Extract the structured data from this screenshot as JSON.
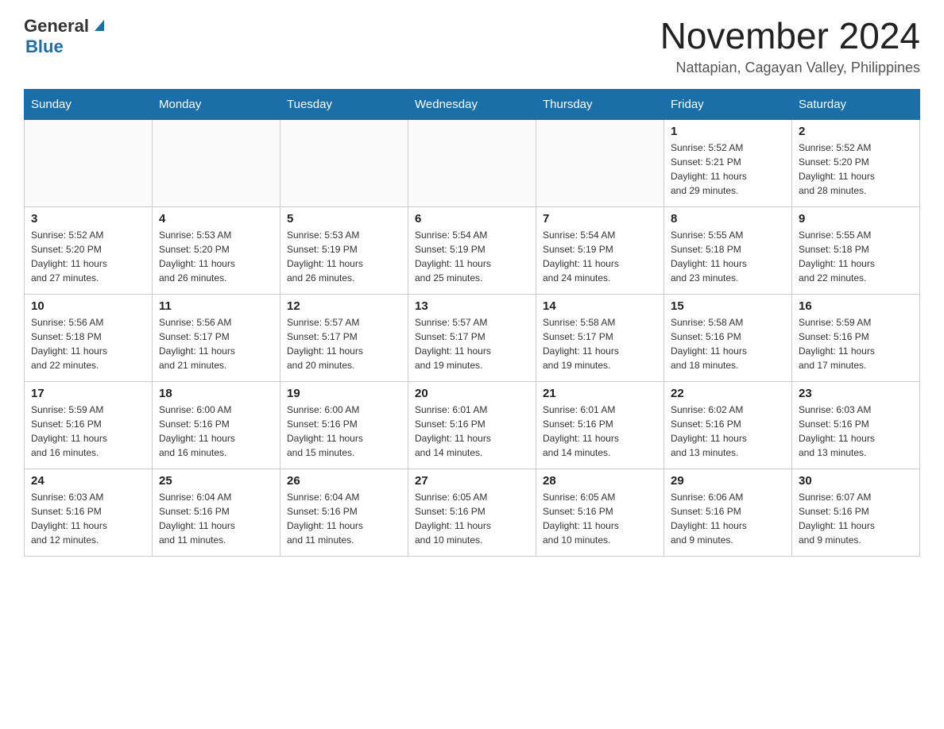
{
  "logo": {
    "general": "General",
    "blue": "Blue",
    "triangle": "▶"
  },
  "title": "November 2024",
  "subtitle": "Nattapian, Cagayan Valley, Philippines",
  "days_of_week": [
    "Sunday",
    "Monday",
    "Tuesday",
    "Wednesday",
    "Thursday",
    "Friday",
    "Saturday"
  ],
  "weeks": [
    {
      "days": [
        {
          "number": "",
          "info": ""
        },
        {
          "number": "",
          "info": ""
        },
        {
          "number": "",
          "info": ""
        },
        {
          "number": "",
          "info": ""
        },
        {
          "number": "",
          "info": ""
        },
        {
          "number": "1",
          "info": "Sunrise: 5:52 AM\nSunset: 5:21 PM\nDaylight: 11 hours\nand 29 minutes."
        },
        {
          "number": "2",
          "info": "Sunrise: 5:52 AM\nSunset: 5:20 PM\nDaylight: 11 hours\nand 28 minutes."
        }
      ]
    },
    {
      "days": [
        {
          "number": "3",
          "info": "Sunrise: 5:52 AM\nSunset: 5:20 PM\nDaylight: 11 hours\nand 27 minutes."
        },
        {
          "number": "4",
          "info": "Sunrise: 5:53 AM\nSunset: 5:20 PM\nDaylight: 11 hours\nand 26 minutes."
        },
        {
          "number": "5",
          "info": "Sunrise: 5:53 AM\nSunset: 5:19 PM\nDaylight: 11 hours\nand 26 minutes."
        },
        {
          "number": "6",
          "info": "Sunrise: 5:54 AM\nSunset: 5:19 PM\nDaylight: 11 hours\nand 25 minutes."
        },
        {
          "number": "7",
          "info": "Sunrise: 5:54 AM\nSunset: 5:19 PM\nDaylight: 11 hours\nand 24 minutes."
        },
        {
          "number": "8",
          "info": "Sunrise: 5:55 AM\nSunset: 5:18 PM\nDaylight: 11 hours\nand 23 minutes."
        },
        {
          "number": "9",
          "info": "Sunrise: 5:55 AM\nSunset: 5:18 PM\nDaylight: 11 hours\nand 22 minutes."
        }
      ]
    },
    {
      "days": [
        {
          "number": "10",
          "info": "Sunrise: 5:56 AM\nSunset: 5:18 PM\nDaylight: 11 hours\nand 22 minutes."
        },
        {
          "number": "11",
          "info": "Sunrise: 5:56 AM\nSunset: 5:17 PM\nDaylight: 11 hours\nand 21 minutes."
        },
        {
          "number": "12",
          "info": "Sunrise: 5:57 AM\nSunset: 5:17 PM\nDaylight: 11 hours\nand 20 minutes."
        },
        {
          "number": "13",
          "info": "Sunrise: 5:57 AM\nSunset: 5:17 PM\nDaylight: 11 hours\nand 19 minutes."
        },
        {
          "number": "14",
          "info": "Sunrise: 5:58 AM\nSunset: 5:17 PM\nDaylight: 11 hours\nand 19 minutes."
        },
        {
          "number": "15",
          "info": "Sunrise: 5:58 AM\nSunset: 5:16 PM\nDaylight: 11 hours\nand 18 minutes."
        },
        {
          "number": "16",
          "info": "Sunrise: 5:59 AM\nSunset: 5:16 PM\nDaylight: 11 hours\nand 17 minutes."
        }
      ]
    },
    {
      "days": [
        {
          "number": "17",
          "info": "Sunrise: 5:59 AM\nSunset: 5:16 PM\nDaylight: 11 hours\nand 16 minutes."
        },
        {
          "number": "18",
          "info": "Sunrise: 6:00 AM\nSunset: 5:16 PM\nDaylight: 11 hours\nand 16 minutes."
        },
        {
          "number": "19",
          "info": "Sunrise: 6:00 AM\nSunset: 5:16 PM\nDaylight: 11 hours\nand 15 minutes."
        },
        {
          "number": "20",
          "info": "Sunrise: 6:01 AM\nSunset: 5:16 PM\nDaylight: 11 hours\nand 14 minutes."
        },
        {
          "number": "21",
          "info": "Sunrise: 6:01 AM\nSunset: 5:16 PM\nDaylight: 11 hours\nand 14 minutes."
        },
        {
          "number": "22",
          "info": "Sunrise: 6:02 AM\nSunset: 5:16 PM\nDaylight: 11 hours\nand 13 minutes."
        },
        {
          "number": "23",
          "info": "Sunrise: 6:03 AM\nSunset: 5:16 PM\nDaylight: 11 hours\nand 13 minutes."
        }
      ]
    },
    {
      "days": [
        {
          "number": "24",
          "info": "Sunrise: 6:03 AM\nSunset: 5:16 PM\nDaylight: 11 hours\nand 12 minutes."
        },
        {
          "number": "25",
          "info": "Sunrise: 6:04 AM\nSunset: 5:16 PM\nDaylight: 11 hours\nand 11 minutes."
        },
        {
          "number": "26",
          "info": "Sunrise: 6:04 AM\nSunset: 5:16 PM\nDaylight: 11 hours\nand 11 minutes."
        },
        {
          "number": "27",
          "info": "Sunrise: 6:05 AM\nSunset: 5:16 PM\nDaylight: 11 hours\nand 10 minutes."
        },
        {
          "number": "28",
          "info": "Sunrise: 6:05 AM\nSunset: 5:16 PM\nDaylight: 11 hours\nand 10 minutes."
        },
        {
          "number": "29",
          "info": "Sunrise: 6:06 AM\nSunset: 5:16 PM\nDaylight: 11 hours\nand 9 minutes."
        },
        {
          "number": "30",
          "info": "Sunrise: 6:07 AM\nSunset: 5:16 PM\nDaylight: 11 hours\nand 9 minutes."
        }
      ]
    }
  ]
}
